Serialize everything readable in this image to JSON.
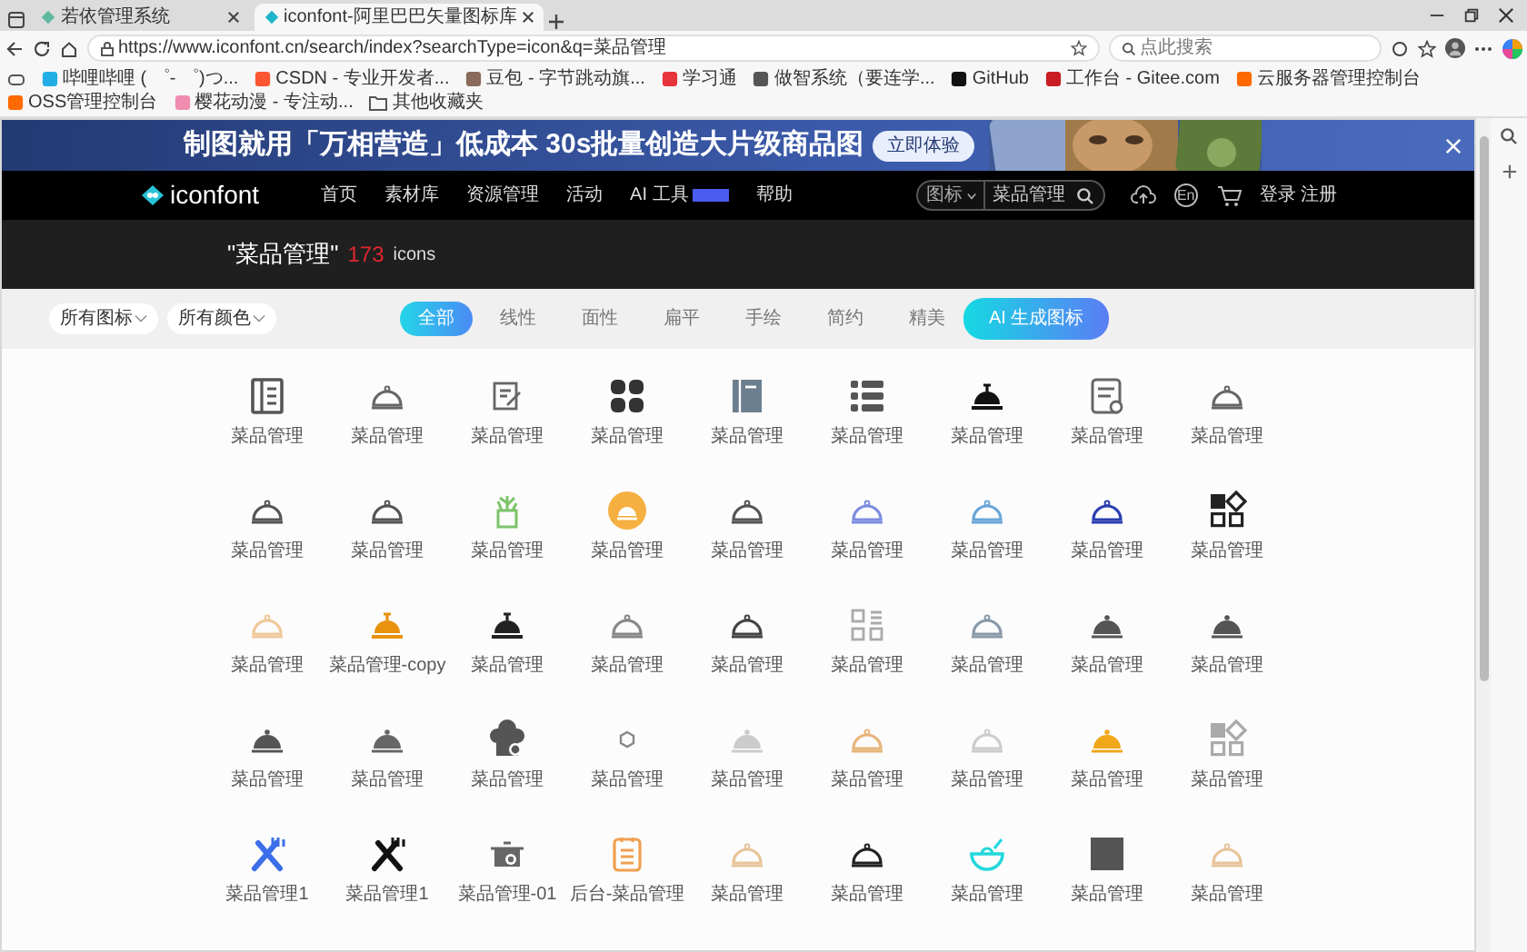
{
  "browser": {
    "tabs": [
      {
        "title": "若依管理系统",
        "selected": false
      },
      {
        "title": "iconfont-阿里巴巴矢量图标库",
        "selected": true
      }
    ],
    "url": "https://www.iconfont.cn/search/index?searchType=icon&q=菜品管理",
    "search_placeholder": "点此搜索",
    "bookmarks": [
      {
        "title": "哔哩哔哩 ( ゜- ゜)つ...",
        "kind": "site",
        "color": "#23ade5"
      },
      {
        "title": "CSDN - 专业开发者...",
        "kind": "site",
        "color": "#fc5531"
      },
      {
        "title": "豆包 - 字节跳动旗...",
        "kind": "site",
        "color": "#8a6a5a"
      },
      {
        "title": "学习通",
        "kind": "site",
        "color": "#e8353b"
      },
      {
        "title": "做智系统（要连学...",
        "kind": "site",
        "color": "#555555"
      },
      {
        "title": "GitHub",
        "kind": "site",
        "color": "#111111"
      },
      {
        "title": "工作台 - Gitee.com",
        "kind": "site",
        "color": "#c71d23"
      },
      {
        "title": "云服务器管理控制台",
        "kind": "site",
        "color": "#ff6a00"
      },
      {
        "title": "OSS管理控制台",
        "kind": "site",
        "color": "#ff6a00"
      },
      {
        "title": "樱花动漫 - 专注动...",
        "kind": "site",
        "color": "#f08cb0"
      },
      {
        "title": "其他收藏夹",
        "kind": "folder",
        "color": "#555555"
      }
    ]
  },
  "banner": {
    "headline": "制图就用「万相营造」低成本 30s批量创造大片级商品图",
    "button": "立即体验"
  },
  "navbar": {
    "logo": "iconfont",
    "items": [
      {
        "label": "首页",
        "badge": false
      },
      {
        "label": "素材库",
        "badge": false
      },
      {
        "label": "资源管理",
        "badge": false
      },
      {
        "label": "活动",
        "badge": false
      },
      {
        "label": "AI 工具",
        "badge": true
      },
      {
        "label": "帮助",
        "badge": false
      }
    ],
    "search": {
      "scope": "图标",
      "value": "菜品管理"
    },
    "lang": "En",
    "login": "登录",
    "register": "注册"
  },
  "result": {
    "query": "\"菜品管理\"",
    "count": "173",
    "unit": "icons"
  },
  "filters": {
    "selects": [
      "所有图标",
      "所有颜色"
    ],
    "styles": [
      {
        "label": "全部",
        "selected": true
      },
      {
        "label": "线性",
        "selected": false
      },
      {
        "label": "面性",
        "selected": false
      },
      {
        "label": "扁平",
        "selected": false
      },
      {
        "label": "手绘",
        "selected": false
      },
      {
        "label": "简约",
        "selected": false
      },
      {
        "label": "精美",
        "selected": false
      }
    ],
    "ai_button": "AI 生成图标"
  },
  "icons": [
    {
      "kind": "doc-lines",
      "color": "#555555",
      "label": "菜品管理"
    },
    {
      "kind": "cloche",
      "color": "#666666",
      "label": "菜品管理"
    },
    {
      "kind": "edit",
      "color": "#666666",
      "label": "菜品管理"
    },
    {
      "kind": "dots4",
      "color": "#333333",
      "label": "菜品管理"
    },
    {
      "kind": "book",
      "color": "#6b7f8f",
      "label": "菜品管理"
    },
    {
      "kind": "list",
      "color": "#555555",
      "label": "菜品管理"
    },
    {
      "kind": "bell",
      "color": "#111111",
      "label": "菜品管理"
    },
    {
      "kind": "doc-gear",
      "color": "#666666",
      "label": "菜品管理"
    },
    {
      "kind": "cloche",
      "color": "#666666",
      "label": "菜品管理"
    },
    {
      "kind": "cloche",
      "color": "#555555",
      "label": "菜品管理"
    },
    {
      "kind": "cloche",
      "color": "#555555",
      "label": "菜品管理"
    },
    {
      "kind": "plant",
      "color": "#7cc36a",
      "label": "菜品管理"
    },
    {
      "kind": "cloche-circle",
      "color": "#f5b041",
      "label": "菜品管理"
    },
    {
      "kind": "cloche",
      "color": "#555555",
      "label": "菜品管理"
    },
    {
      "kind": "cloche",
      "color": "#7b8de0",
      "label": "菜品管理"
    },
    {
      "kind": "cloche",
      "color": "#6aa6d8",
      "label": "菜品管理"
    },
    {
      "kind": "cloche",
      "color": "#2b3fb0",
      "label": "菜品管理"
    },
    {
      "kind": "apps",
      "color": "#222222",
      "label": "菜品管理"
    },
    {
      "kind": "cloche",
      "color": "#f0c89a",
      "label": "菜品管理"
    },
    {
      "kind": "bell",
      "color": "#e8920f",
      "label": "菜品管理-copy"
    },
    {
      "kind": "bell",
      "color": "#222222",
      "label": "菜品管理"
    },
    {
      "kind": "cloche",
      "color": "#888888",
      "label": "菜品管理"
    },
    {
      "kind": "cloche",
      "color": "#444444",
      "label": "菜品管理"
    },
    {
      "kind": "grid-lines",
      "color": "#aaaaaa",
      "label": "菜品管理"
    },
    {
      "kind": "cloche",
      "color": "#8a9aa8",
      "label": "菜品管理"
    },
    {
      "kind": "cloche-fill",
      "color": "#555555",
      "label": "菜品管理"
    },
    {
      "kind": "cloche-fill",
      "color": "#555555",
      "label": "菜品管理"
    },
    {
      "kind": "cloche-fill",
      "color": "#555555",
      "label": "菜品管理"
    },
    {
      "kind": "cloche-fill",
      "color": "#666666",
      "label": "菜品管理"
    },
    {
      "kind": "chef",
      "color": "#555555",
      "label": "菜品管理"
    },
    {
      "kind": "hexagon",
      "color": "#888888",
      "label": "菜品管理"
    },
    {
      "kind": "cloche-fill",
      "color": "#cccccc",
      "label": "菜品管理"
    },
    {
      "kind": "cloche",
      "color": "#e8b47a",
      "label": "菜品管理"
    },
    {
      "kind": "cloche",
      "color": "#cccccc",
      "label": "菜品管理"
    },
    {
      "kind": "cloche-fill",
      "color": "#f0a818",
      "label": "菜品管理"
    },
    {
      "kind": "apps",
      "color": "#aaaaaa",
      "label": "菜品管理"
    },
    {
      "kind": "fork",
      "color": "#3b6ee8",
      "label": "菜品管理1"
    },
    {
      "kind": "fork",
      "color": "#111111",
      "label": "菜品管理1"
    },
    {
      "kind": "pot",
      "color": "#666666",
      "label": "菜品管理-01"
    },
    {
      "kind": "clipboard",
      "color": "#f0a050",
      "label": "后台-菜品管理"
    },
    {
      "kind": "cloche",
      "color": "#e8c49a",
      "label": "菜品管理"
    },
    {
      "kind": "cloche",
      "color": "#222222",
      "label": "菜品管理"
    },
    {
      "kind": "bowl",
      "color": "#22d8dc",
      "label": "菜品管理"
    },
    {
      "kind": "square",
      "color": "#555555",
      "label": "菜品管理"
    },
    {
      "kind": "cloche",
      "color": "#e8c49a",
      "label": "菜品管理"
    }
  ]
}
